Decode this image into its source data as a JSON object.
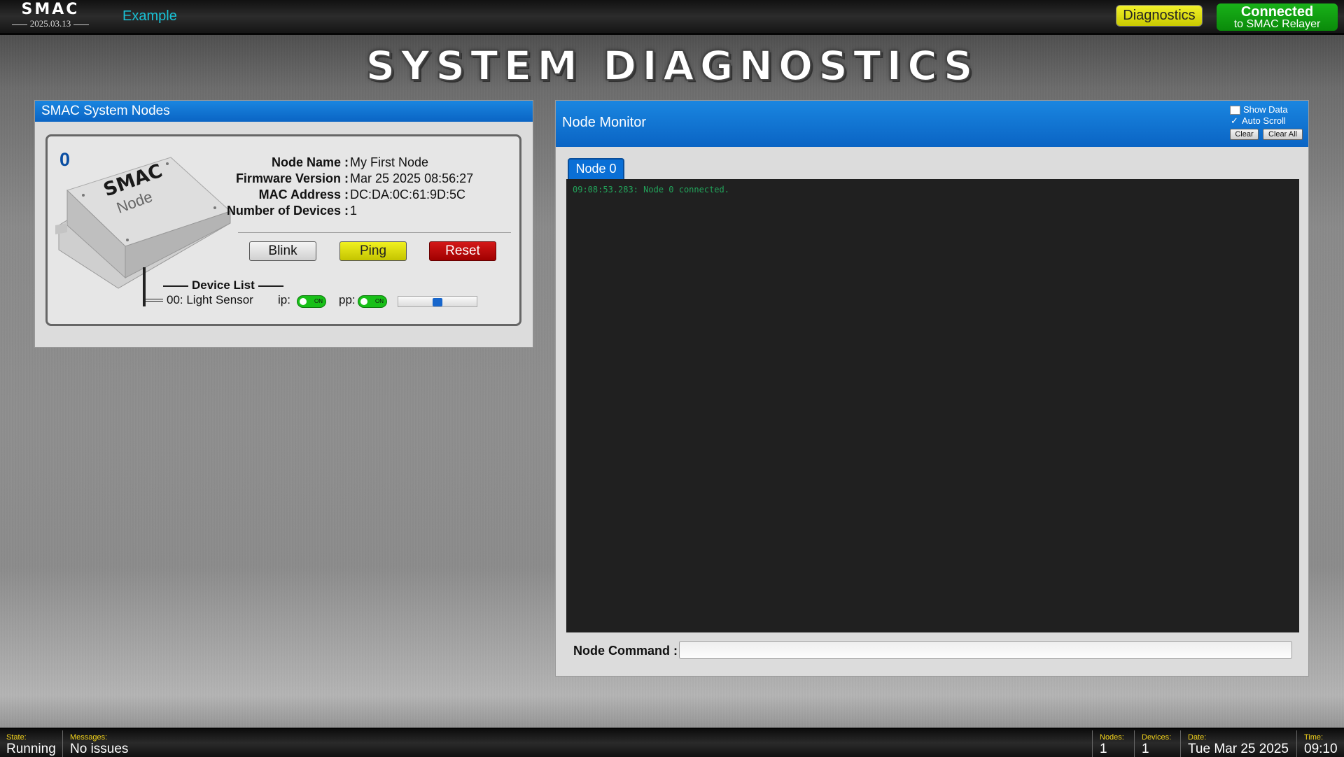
{
  "topbar": {
    "logo_name": "SMAC",
    "logo_version": "2025.03.13",
    "app_name": "Example",
    "diagnostics_label": "Diagnostics",
    "connection_line1": "Connected",
    "connection_line2": "to SMAC Relayer",
    "colors": {
      "diagnostics": "#e2e214",
      "connected": "#12a212",
      "app_link": "#19c2d6"
    }
  },
  "page": {
    "title": "SYSTEM DIAGNOSTICS"
  },
  "nodes_panel": {
    "title": "SMAC System Nodes",
    "node": {
      "number": "0",
      "image_text_1": "SMAC",
      "image_text_2": "Node",
      "fields": [
        {
          "label": "Node Name :",
          "value": "My First Node"
        },
        {
          "label": "Firmware Version :",
          "value": "Mar 25 2025 08:56:27"
        },
        {
          "label": "MAC Address :",
          "value": "DC:DA:0C:61:9D:5C"
        },
        {
          "label": "Number of Devices :",
          "value": "1"
        }
      ],
      "buttons": {
        "blink": "Blink",
        "ping": "Ping",
        "reset": "Reset"
      },
      "device_list_title": "Device List",
      "devices": [
        {
          "name": "00: Light Sensor",
          "ip_label": "ip:",
          "ip_state": "ON",
          "pp_label": "pp:",
          "pp_state": "ON",
          "slider_value": 0.5
        }
      ]
    }
  },
  "monitor_panel": {
    "title": "Node Monitor",
    "show_data_label": "Show Data",
    "show_data_checked": false,
    "auto_scroll_label": "Auto Scroll",
    "auto_scroll_checked": true,
    "clear_label": "Clear",
    "clear_all_label": "Clear All",
    "tabs": [
      {
        "label": "Node 0",
        "active": true
      }
    ],
    "console_lines": [
      "09:08:53.283: Node 0 connected."
    ],
    "command_label": "Node Command :",
    "command_value": ""
  },
  "statusbar": {
    "state_label": "State:",
    "state_value": "Running",
    "messages_label": "Messages:",
    "messages_value": "No issues",
    "nodes_label": "Nodes:",
    "nodes_value": "1",
    "devices_label": "Devices:",
    "devices_value": "1",
    "date_label": "Date:",
    "date_value": "Tue Mar 25 2025",
    "time_label": "Time:",
    "time_value": "09:10"
  }
}
